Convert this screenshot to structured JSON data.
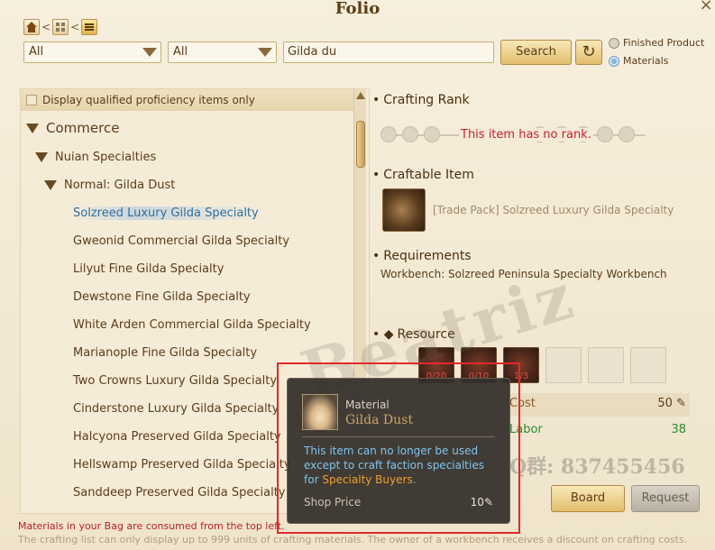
{
  "window": {
    "title": "Folio",
    "close": "×"
  },
  "filters": {
    "category_1": "All",
    "category_2": "All",
    "search_value": "Gilda du",
    "search_button": "Search",
    "radio_finished": "Finished Product",
    "radio_materials": "Materials",
    "selected_radio": "Materials"
  },
  "list": {
    "qualify_label": "Display qualified proficiency items only",
    "groups": [
      {
        "label": "Commerce",
        "level": 0
      },
      {
        "label": "Nuian Specialties",
        "level": 1
      },
      {
        "label": "Normal: Gilda Dust",
        "level": 2
      }
    ],
    "items": [
      "Solzreed Luxury Gilda Specialty",
      "Gweonid Commercial Gilda Specialty",
      "Lilyut Fine Gilda Specialty",
      "Dewstone Fine Gilda Specialty",
      "White Arden Commercial Gilda Specialty",
      "Marianople Fine Gilda Specialty",
      "Two Crowns Luxury Gilda Specialty",
      "Cinderstone Luxury Gilda Specialty",
      "Halcyona Preserved Gilda Specialty",
      "Hellswamp Preserved Gilda Specialty",
      "Sanddeep Preserved Gilda Specialty"
    ],
    "selected_index": 0
  },
  "details": {
    "rank_title": "Crafting Rank",
    "rank_note": "This item has no rank.",
    "craftable_title": "Craftable Item",
    "craftable_name": "[Trade Pack] Solzreed Luxury Gilda Specialty",
    "requirements_title": "Requirements",
    "requirements_text": "Workbench: Solzreed Peninsula Specialty Workbench",
    "resource_title": "Resource",
    "resources": [
      {
        "count": "0/20",
        "filled": true
      },
      {
        "count": "0/10",
        "filled": true
      },
      {
        "count": "1/3",
        "filled": true
      },
      {
        "count": "",
        "filled": false
      },
      {
        "count": "",
        "filled": false
      },
      {
        "count": "",
        "filled": false
      }
    ],
    "cost_label": "Cost",
    "cost_value": "50",
    "labor_label": "Labor",
    "labor_value": "38",
    "board_button": "Board",
    "request_button": "Request"
  },
  "footer": {
    "note_red": "Materials in your Bag are consumed from the top left.",
    "note_grey": "The crafting list can only display up to 999 units of crafting materials. The owner of a workbench receives a discount on crafting costs."
  },
  "watermark": {
    "text": "Beatriz",
    "qq": "Q群: 837455456"
  },
  "tooltip": {
    "type": "Material",
    "name": "Gilda Dust",
    "desc_before": "This item can no longer be used except to craft faction specialties for ",
    "desc_highlight": "Specialty Buyers",
    "desc_after": ".",
    "price_label": "Shop Price",
    "price_value": "10"
  }
}
